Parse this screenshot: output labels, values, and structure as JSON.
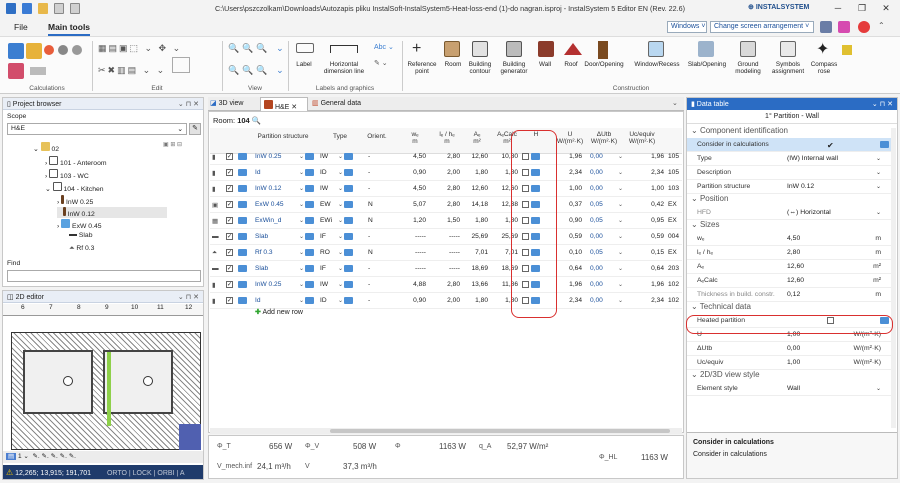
{
  "window": {
    "title": "C:\\Users\\pszczolkam\\Downloads\\Autozapis pliku InstalSoft-InstalSystem5-Heat-loss-end (1)-do nagran.isproj - InstalSystem 5 Editor EN (Rev. 22.6)",
    "logo": "INSTALSYSTEM"
  },
  "menu": {
    "file": "File",
    "main_tools": "Main tools",
    "windows_label": "Windows",
    "arrangement_label": "Change screen arrangement"
  },
  "ribbon": {
    "groups": {
      "calculations": "Calculations",
      "edit": "Edit",
      "view": "View",
      "labels": "Labels and graphics",
      "construction": "Construction"
    },
    "buttons": {
      "label": "Label",
      "hdim": "Horizontal dimension line",
      "ref": "Reference point",
      "room": "Room",
      "building_contour": "Building contour",
      "building_gen": "Building generator",
      "wall": "Wall",
      "roof": "Roof",
      "door": "Door/Opening",
      "window": "Window/Recess",
      "slab": "Slab/Opening",
      "ground": "Ground modeling",
      "symbols": "Symbols assignment",
      "compass": "Compass rose"
    }
  },
  "project_browser": {
    "title": "Project browser",
    "scope_label": "Scope",
    "scope_value": "H&E",
    "items": [
      {
        "label": "02"
      },
      {
        "label": "101 - Anteroom"
      },
      {
        "label": "103 - WC"
      },
      {
        "label": "104 - Kitchen"
      },
      {
        "label": "InW 0.25"
      },
      {
        "label": "InW 0.12"
      },
      {
        "label": "ExW 0.45"
      },
      {
        "label": "Slab"
      },
      {
        "label": "Rf 0.3"
      }
    ],
    "find_label": "Find"
  },
  "editor2d": {
    "title": "2D editor",
    "ruler": [
      "6",
      "7",
      "8",
      "9",
      "10",
      "11",
      "12"
    ],
    "status_coords": "12,265; 13,915; 191,701",
    "status_flags": "ORTO | LOCK | ORBI | A",
    "floor": "1"
  },
  "tabs": {
    "view3d": "3D view",
    "he": "H&E",
    "general": "General data"
  },
  "room": {
    "label": "Room:",
    "number": "104"
  },
  "table": {
    "headers": [
      "Partition structure",
      "Type",
      "Orient.",
      "wₑ",
      "lₑ / hₑ",
      "Aₑ",
      "AₑCalc",
      "H",
      "U",
      "ΔUtb",
      "Uc/equiv"
    ],
    "units": [
      "",
      "",
      "",
      "m",
      "m",
      "m²",
      "m²",
      "",
      "W/(m²·K)",
      "W/(m²·K)",
      "W/(m²·K)"
    ],
    "rows": [
      {
        "ps": "InW 0.25",
        "type": "IW",
        "orient": "-",
        "we": "4,50",
        "le": "2,80",
        "ae": "12,60",
        "acalc": "10,80",
        "u": "1,96",
        "dutb": "0,00",
        "uc": "1,96",
        "x": "105"
      },
      {
        "ps": "Id",
        "type": "ID",
        "orient": "-",
        "we": "0,90",
        "le": "2,00",
        "ae": "1,80",
        "acalc": "1,80",
        "u": "2,34",
        "dutb": "0,00",
        "uc": "2,34",
        "x": "105"
      },
      {
        "ps": "InW 0.12",
        "type": "IW",
        "orient": "-",
        "we": "4,50",
        "le": "2,80",
        "ae": "12,60",
        "acalc": "12,60",
        "u": "1,00",
        "dutb": "0,00",
        "uc": "1,00",
        "x": "103"
      },
      {
        "ps": "ExW 0.45",
        "type": "EW",
        "orient": "N",
        "we": "5,07",
        "le": "2,80",
        "ae": "14,18",
        "acalc": "12,38",
        "u": "0,37",
        "dutb": "0,05",
        "uc": "0,42",
        "x": "EX"
      },
      {
        "ps": "ExWin_d",
        "type": "EWi",
        "orient": "N",
        "we": "1,20",
        "le": "1,50",
        "ae": "1,80",
        "acalc": "1,80",
        "u": "0,90",
        "dutb": "0,05",
        "uc": "0,95",
        "x": "EX"
      },
      {
        "ps": "Slab",
        "type": "IF",
        "orient": "-",
        "we": "-----",
        "le": "-----",
        "ae": "25,69",
        "acalc": "25,69",
        "u": "0,59",
        "dutb": "0,00",
        "uc": "0,59",
        "x": "004"
      },
      {
        "ps": "Rf 0.3",
        "type": "RO",
        "orient": "N",
        "we": "-----",
        "le": "-----",
        "ae": "7,01",
        "acalc": "7,01",
        "u": "0,10",
        "dutb": "0,05",
        "uc": "0,15",
        "x": "EX"
      },
      {
        "ps": "Slab",
        "type": "IF",
        "orient": "-",
        "we": "-----",
        "le": "-----",
        "ae": "18,69",
        "acalc": "18,69",
        "u": "0,64",
        "dutb": "0,00",
        "uc": "0,64",
        "x": "203"
      },
      {
        "ps": "InW 0.25",
        "type": "IW",
        "orient": "-",
        "we": "4,88",
        "le": "2,80",
        "ae": "13,66",
        "acalc": "11,86",
        "u": "1,96",
        "dutb": "0,00",
        "uc": "1,96",
        "x": "102"
      },
      {
        "ps": "Id",
        "type": "ID",
        "orient": "-",
        "we": "0,90",
        "le": "2,00",
        "ae": "1,80",
        "acalc": "1,80",
        "u": "2,34",
        "dutb": "0,00",
        "uc": "2,34",
        "x": "102"
      }
    ],
    "add_row": "Add new row"
  },
  "summary": {
    "phi_t_label": "Φ_T",
    "phi_t": "656 W",
    "phi_v_label": "Φ_V",
    "phi_v": "508 W",
    "phi_label": "Φ",
    "phi": "1163 W",
    "qa_label": "q_A",
    "qa": "52,97 W/m²",
    "phi_hl_label": "Φ_HL",
    "phi_hl": "1163 W",
    "vmech_label": "V_mech.inf",
    "vmech": "24,1 m³/h",
    "v_label": "V",
    "v": "37,3 m³/h"
  },
  "data_table": {
    "title": "Data table",
    "object": "1° Partition - Wall",
    "sections": {
      "component": "Component identification",
      "position": "Position",
      "sizes": "Sizes",
      "technical": "Technical data",
      "view": "2D/3D view style"
    },
    "rows": {
      "consider": {
        "k": "Consider in calculations"
      },
      "type": {
        "k": "Type",
        "v": "(IW) Internal wall"
      },
      "description": {
        "k": "Description",
        "v": ""
      },
      "partition": {
        "k": "Partition structure",
        "v": "InW 0.12"
      },
      "hfd": {
        "k": "HFD",
        "v": "(⇔) Horizontal"
      },
      "we": {
        "k": "wₑ",
        "v": "4,50",
        "u": "m"
      },
      "le": {
        "k": "lₑ / hₑ",
        "v": "2,80",
        "u": "m"
      },
      "ae": {
        "k": "Aₑ",
        "v": "12,60",
        "u": "m²"
      },
      "acalc": {
        "k": "AₑCalc",
        "v": "12,60",
        "u": "m²"
      },
      "thick": {
        "k": "Thickness in build. constr.",
        "v": "0,12",
        "u": "m"
      },
      "heated": {
        "k": "Heated partition"
      },
      "u": {
        "k": "U",
        "v": "1,00",
        "u": "W/(m²·K)"
      },
      "dutb": {
        "k": "ΔUtb",
        "v": "0,00",
        "u": "W/(m²·K)"
      },
      "uc": {
        "k": "Uc/equiv",
        "v": "1,00",
        "u": "W/(m²·K)"
      },
      "style": {
        "k": "Element style",
        "v": "Wall"
      }
    },
    "help_title": "Consider in calculations",
    "help_text": "Consider in calculations"
  }
}
